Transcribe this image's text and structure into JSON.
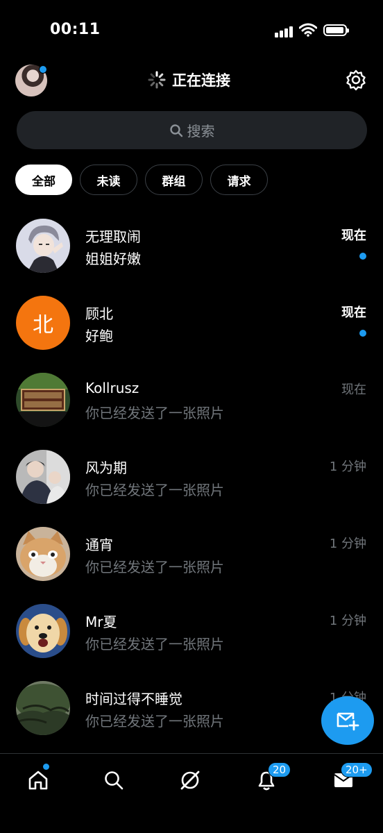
{
  "status_bar": {
    "time": "00:11"
  },
  "header": {
    "title": "正在连接"
  },
  "search": {
    "placeholder": "搜索"
  },
  "filters": [
    "全部",
    "未读",
    "群组",
    "请求"
  ],
  "conversations": [
    {
      "name": "无理取闹",
      "preview": "姐姐好嫩",
      "time": "现在",
      "unread": true,
      "avatar": "anime-avatar"
    },
    {
      "name": "顾北",
      "preview": "好鲍",
      "time": "现在",
      "unread": true,
      "avatar": "letter-avatar",
      "avatar_letter": "北"
    },
    {
      "name": "Kollrusz",
      "preview": "你已经发送了一张照片",
      "time": "现在",
      "unread": false,
      "avatar": "sign-avatar"
    },
    {
      "name": "风为期",
      "preview": "你已经发送了一张照片",
      "time": "1 分钟",
      "unread": false,
      "avatar": "photo-avatar"
    },
    {
      "name": "通宵",
      "preview": "你已经发送了一张照片",
      "time": "1 分钟",
      "unread": false,
      "avatar": "cat-avatar"
    },
    {
      "name": "Mr夏",
      "preview": "你已经发送了一张照片",
      "time": "1 分钟",
      "unread": false,
      "avatar": "dog-avatar"
    },
    {
      "name": "时间过得不睡觉",
      "preview": "你已经发送了一张照片",
      "time": "1 分钟",
      "unread": false,
      "avatar": "tree-avatar"
    }
  ],
  "tabbar": {
    "notifications_badge": "20",
    "messages_badge": "20+"
  },
  "colors": {
    "accent": "#1d9bf0",
    "background": "#000000",
    "muted_text": "#71767b",
    "letter_avatar": "#f4750f"
  }
}
